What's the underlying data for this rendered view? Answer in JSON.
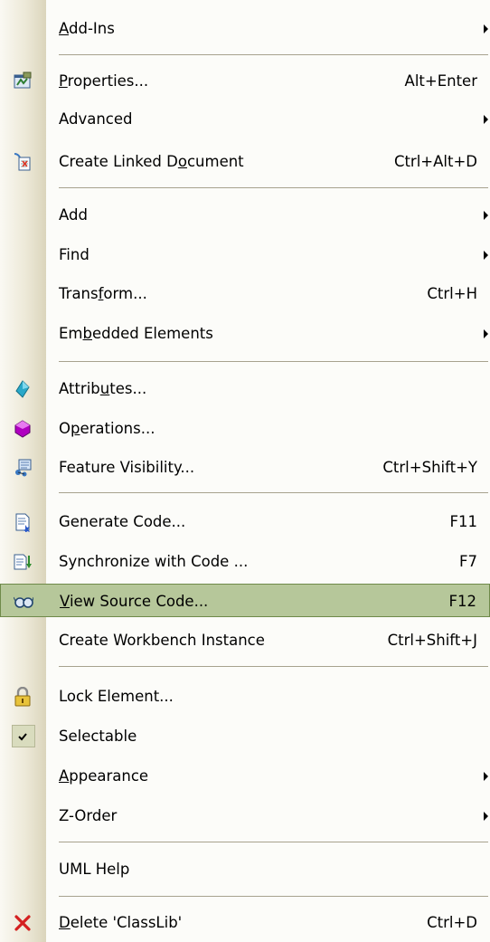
{
  "menu": {
    "items": [
      {
        "id": "add-ins",
        "label": "Add-Ins",
        "mnemonic": 0,
        "submenu": true,
        "icon": "none"
      },
      {
        "id": "properties",
        "label": "Properties...",
        "mnemonic": 0,
        "shortcut": "Alt+Enter",
        "icon": "properties-icon"
      },
      {
        "id": "advanced",
        "label": "Advanced",
        "submenu": true,
        "icon": "none"
      },
      {
        "id": "create-linked-document",
        "label": "Create Linked Document",
        "mnemonic": 15,
        "shortcut": "Ctrl+Alt+D",
        "icon": "linked-document-icon"
      },
      {
        "id": "add",
        "label": "Add",
        "submenu": true,
        "icon": "none"
      },
      {
        "id": "find",
        "label": "Find",
        "submenu": true,
        "icon": "none"
      },
      {
        "id": "transform",
        "label": "Transform...",
        "mnemonic": 5,
        "shortcut": "Ctrl+H",
        "icon": "none"
      },
      {
        "id": "embedded-elements",
        "label": "Embedded Elements",
        "mnemonic": 2,
        "submenu": true,
        "icon": "none"
      },
      {
        "id": "attributes",
        "label": "Attributes...",
        "mnemonic": 6,
        "icon": "attribute-icon"
      },
      {
        "id": "operations",
        "label": "Operations...",
        "mnemonic": 1,
        "icon": "operation-icon"
      },
      {
        "id": "feature-visibility",
        "label": "Feature Visibility...",
        "shortcut": "Ctrl+Shift+Y",
        "icon": "feature-visibility-icon"
      },
      {
        "id": "generate-code",
        "label": "Generate Code...",
        "shortcut": "F11",
        "icon": "generate-code-icon"
      },
      {
        "id": "synchronize-with-code",
        "label": "Synchronize with Code ...",
        "shortcut": "F7",
        "icon": "synchronize-icon"
      },
      {
        "id": "view-source-code",
        "label": "View Source Code...",
        "mnemonic": 0,
        "shortcut": "F12",
        "icon": "view-source-icon",
        "highlight": true
      },
      {
        "id": "create-workbench-instance",
        "label": "Create Workbench Instance",
        "shortcut": "Ctrl+Shift+J",
        "icon": "none"
      },
      {
        "id": "lock-element",
        "label": "Lock Element...",
        "icon": "lock-icon"
      },
      {
        "id": "selectable",
        "label": "Selectable",
        "icon": "checkmark-icon",
        "checked": true
      },
      {
        "id": "appearance",
        "label": "Appearance",
        "mnemonic": 0,
        "submenu": true,
        "icon": "none"
      },
      {
        "id": "z-order",
        "label": "Z-Order",
        "submenu": true,
        "icon": "none"
      },
      {
        "id": "uml-help",
        "label": "UML Help",
        "icon": "none"
      },
      {
        "id": "delete",
        "label": "Delete 'ClassLib'",
        "mnemonic": 0,
        "shortcut": "Ctrl+D",
        "icon": "delete-icon"
      }
    ],
    "colors": {
      "highlight_bg": "#b6c79a",
      "highlight_border": "#6f8a4a",
      "separator": "#a7a28e",
      "gutter": "#e6e1cc"
    }
  }
}
